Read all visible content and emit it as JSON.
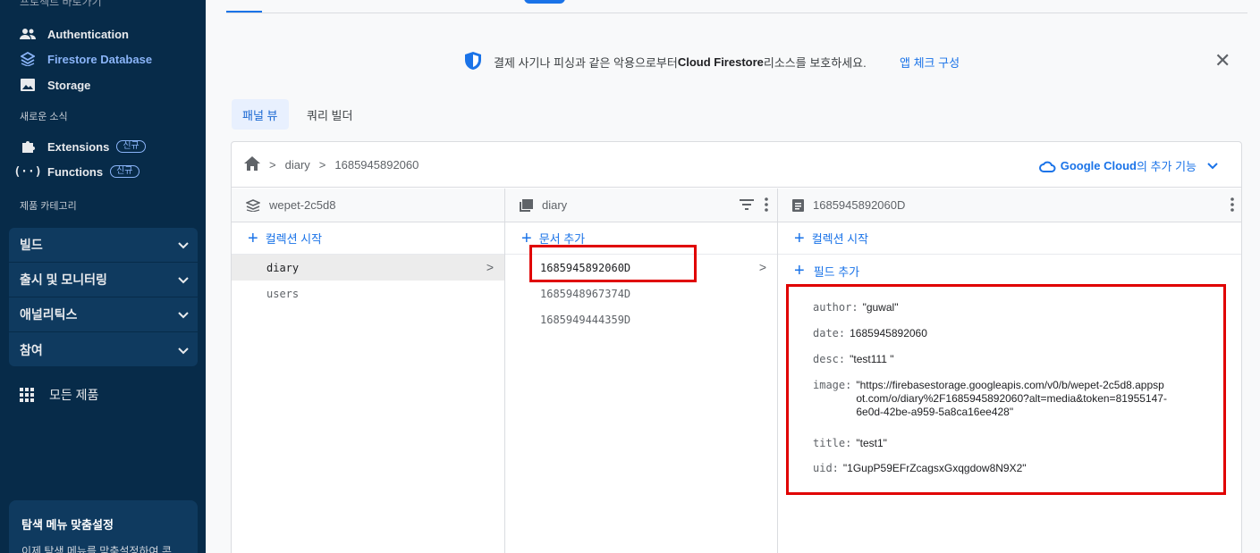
{
  "sidebar": {
    "cut_label": "프로젝트 바로가기",
    "shortcuts": [
      {
        "label": "Authentication",
        "icon": "people-icon"
      },
      {
        "label": "Firestore Database",
        "icon": "firestore-icon"
      },
      {
        "label": "Storage",
        "icon": "image-icon"
      }
    ],
    "new_section": "새로운 소식",
    "new_items": [
      {
        "label": "Extensions",
        "badge": "신규",
        "icon": "puzzle-icon"
      },
      {
        "label": "Functions",
        "badge": "신규",
        "icon": "functions-icon"
      }
    ],
    "category_section": "제품 카테고리",
    "groups": [
      "빌드",
      "출시 및 모니터링",
      "애널리틱스",
      "참여"
    ],
    "all_products": "모든 제품",
    "card": {
      "title": "탐색 메뉴 맞춤설정",
      "desc": "이제 탐색 메뉴를 맞춤설정하여 콘"
    }
  },
  "banner": {
    "text_before": "결제 사기나 피싱과 같은 악용으로부터 ",
    "text_bold": "Cloud Firestore",
    "text_after": " 리소스를 보호하세요.",
    "link": "앱 체크 구성",
    "close": "✕"
  },
  "view_tabs": {
    "panel": "패널 뷰",
    "query": "쿼리 빌더"
  },
  "breadcrumb": {
    "collection": "diary",
    "document": "1685945892060"
  },
  "gcloud": {
    "bold": "Google Cloud",
    "rest": "의 추가 기능"
  },
  "columns": {
    "root": {
      "title": "wepet-2c5d8",
      "add_label": "컬렉션 시작",
      "items": [
        "diary",
        "users"
      ]
    },
    "collection": {
      "title": "diary",
      "add_label": "문서 추가",
      "items": [
        "1685945892060D",
        "1685948967374D",
        "1685949444359D"
      ]
    },
    "document": {
      "title": "1685945892060D",
      "add_collection": "컬렉션 시작",
      "add_field": "필드 추가",
      "fields": [
        {
          "key": "author:",
          "value": "\"guwal\""
        },
        {
          "key": "date:",
          "value": "1685945892060"
        },
        {
          "key": "desc:",
          "value": "\"test111 \""
        },
        {
          "key": "image:",
          "value": "\"https://firebasestorage.googleapis.com/v0/b/wepet-2c5d8.appspot.com/o/diary%2F1685945892060?alt=media&token=81955147-6e0d-42be-a959-5a8ca16ee428\""
        },
        {
          "key": "title:",
          "value": "\"test1\""
        },
        {
          "key": "uid:",
          "value": "\"1GupP59EFrZcagsxGxqgdow8N9X2\""
        }
      ]
    }
  },
  "colors": {
    "accent": "#1a73e8",
    "sidebar_bg": "#072b49",
    "highlight": "#e00000"
  }
}
